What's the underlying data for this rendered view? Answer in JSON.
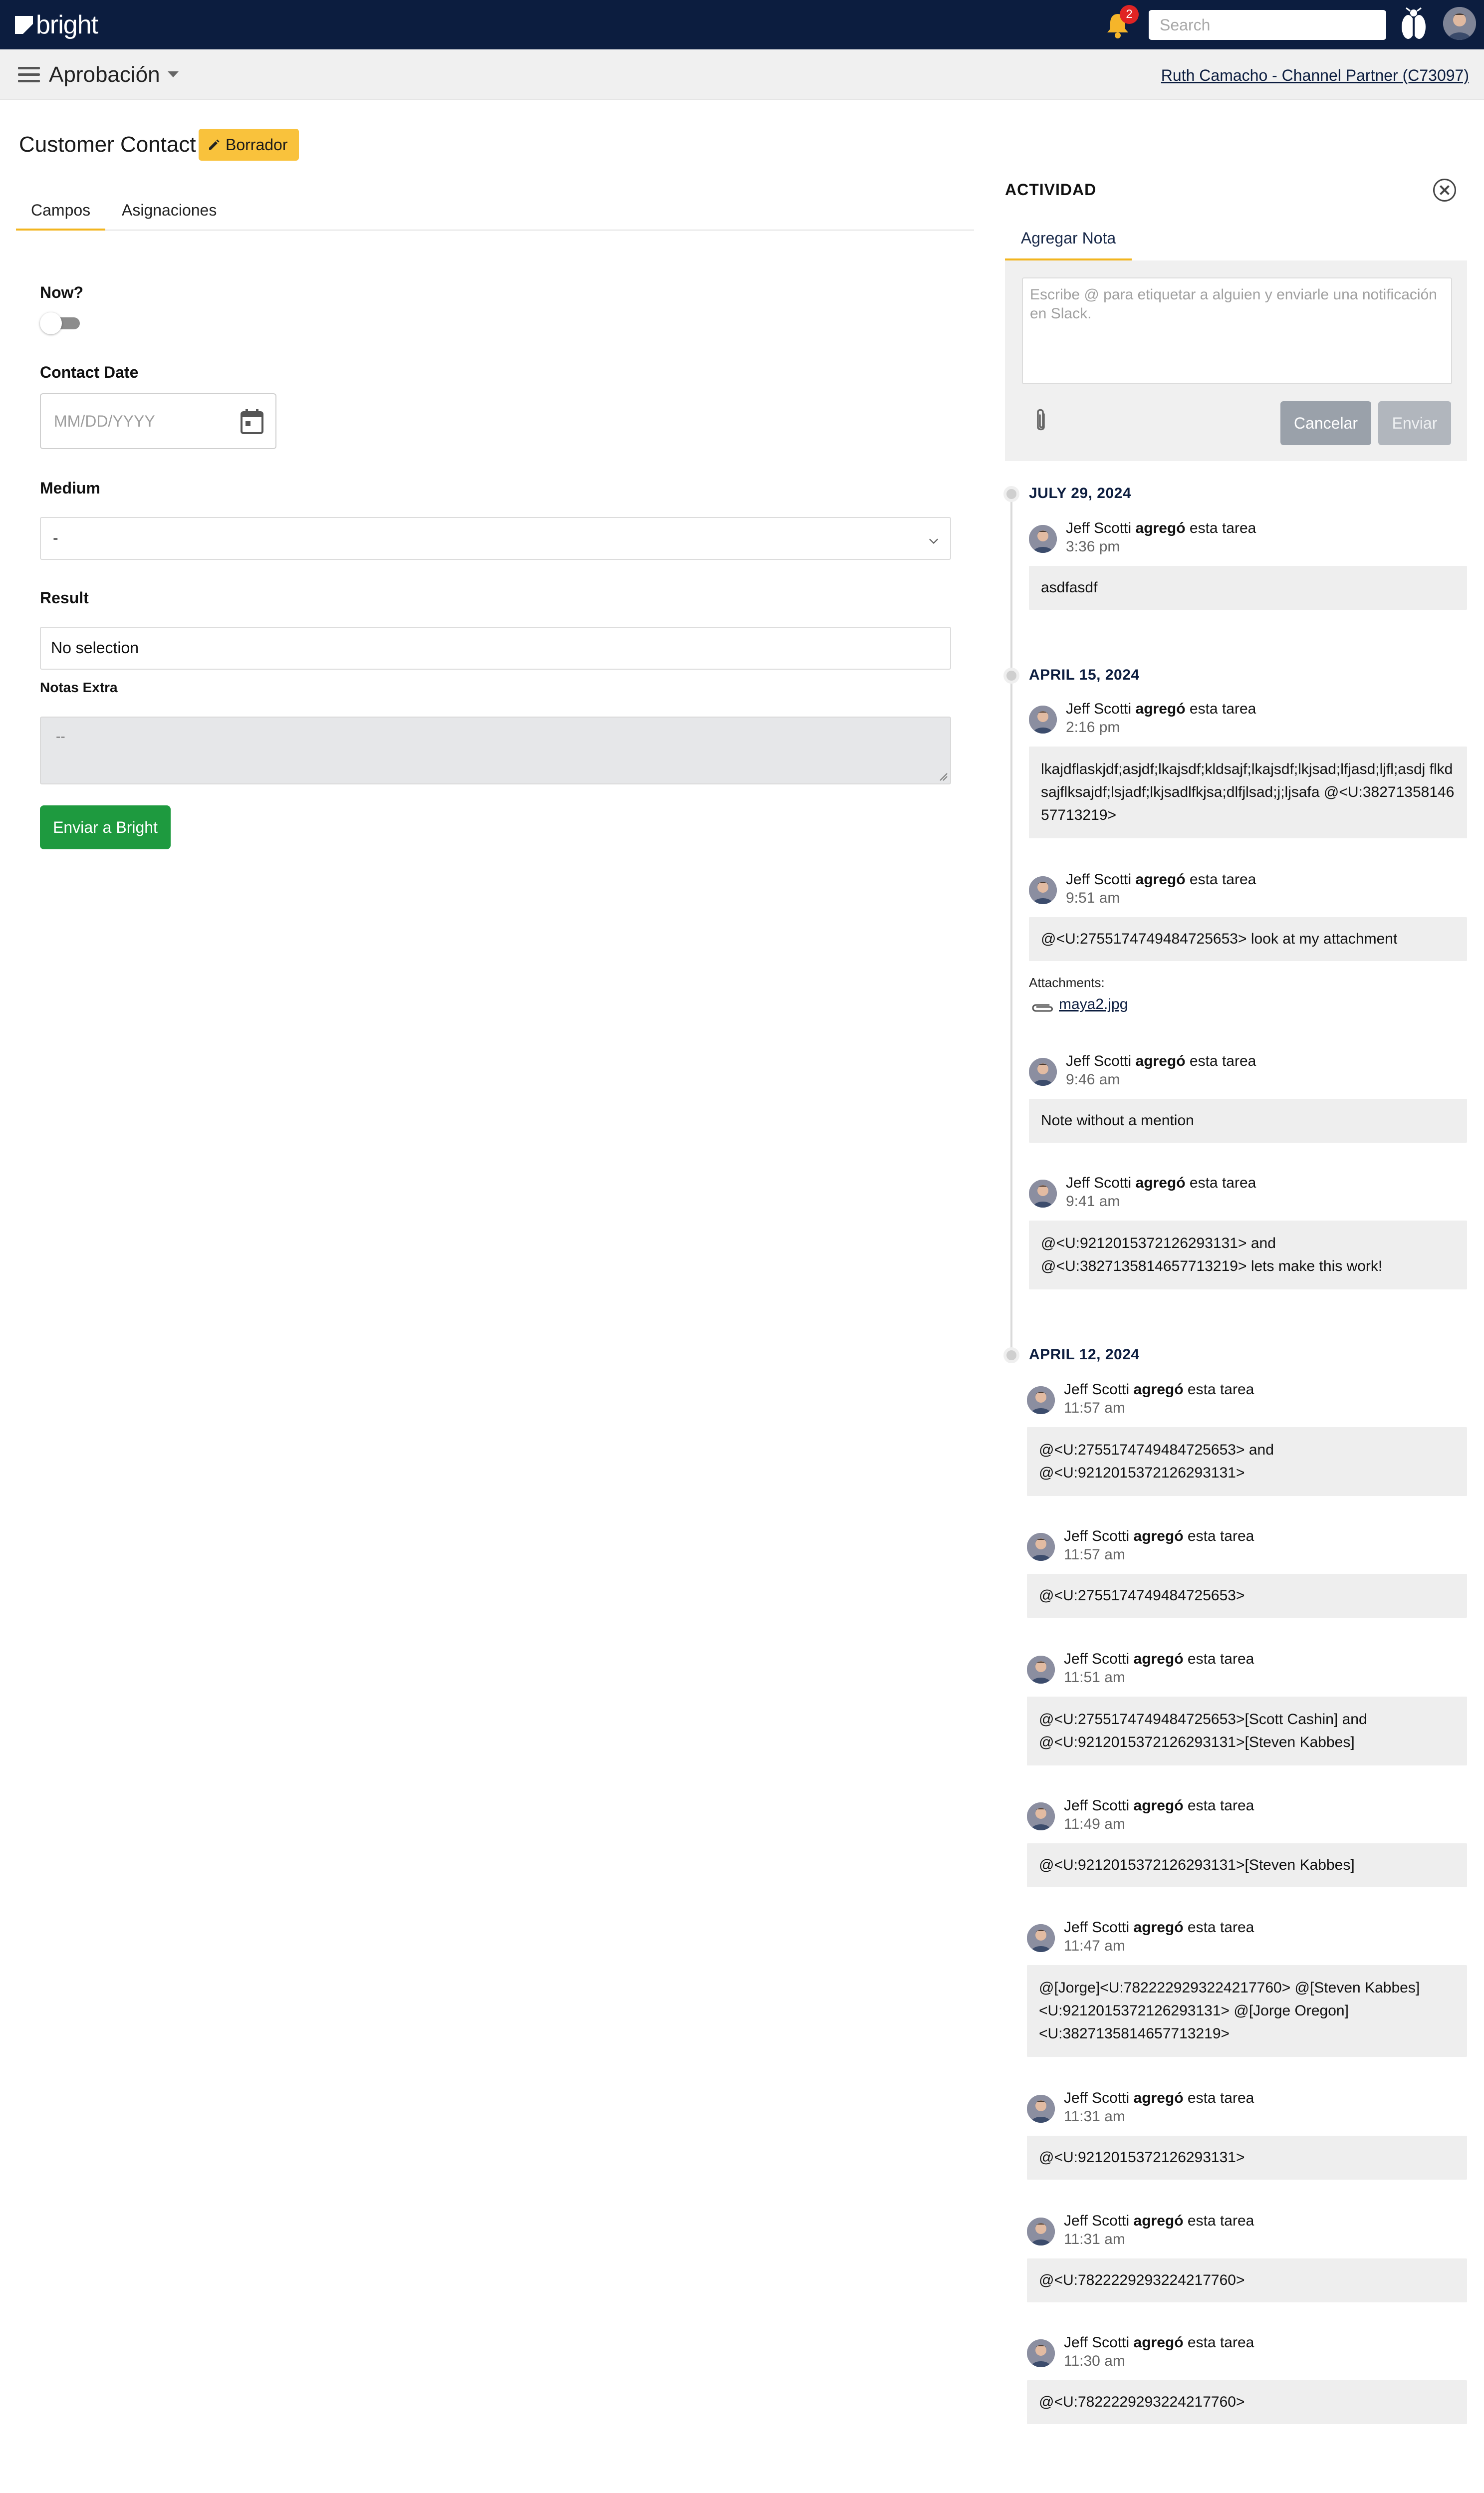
{
  "topbar": {
    "brand": "bright",
    "notification_count": "2",
    "search_placeholder": "Search"
  },
  "subbar": {
    "title": "Aprobación",
    "partner": "Ruth Camacho - Channel Partner (C73097)"
  },
  "form": {
    "title": "Customer Contact",
    "status_badge": "Borrador",
    "tabs": [
      "Campos",
      "Asignaciones"
    ],
    "active_tab": "Campos",
    "fields": {
      "now_label": "Now?",
      "now_value": false,
      "contact_date_label": "Contact Date",
      "contact_date_placeholder": "MM/DD/YYYY",
      "medium_label": "Medium",
      "medium_value": "-",
      "result_label": "Result",
      "result_value": "No selection",
      "extra_label": "Notas Extra",
      "extra_placeholder": "--"
    },
    "submit_label": "Enviar a Bright"
  },
  "activity": {
    "title": "ACTIVIDAD",
    "tab": "Agregar Nota",
    "note_placeholder": "Escribe @ para etiquetar a alguien y enviarle una notificación en Slack.",
    "cancel_label": "Cancelar",
    "send_label": "Enviar",
    "attachments_label": "Attachments:",
    "attachment_file": "maya2.jpg",
    "groups": [
      {
        "date": "JULY 29, 2024"
      },
      {
        "date": "APRIL 15, 2024"
      },
      {
        "date": "APRIL 12, 2024"
      }
    ],
    "entries": [
      {
        "author": "Jeff Scotti",
        "verb": "agregó",
        "suffix": "esta tarea",
        "time": "3:36 pm",
        "body": "asdfasdf"
      },
      {
        "author": "Jeff Scotti",
        "verb": "agregó",
        "suffix": "esta tarea",
        "time": "2:16 pm",
        "body": "lkajdflaskjdf;asjdf;lkajsdf;kldsajf;lkajsdf;lkjsad;lfjasd;ljfl;asdj flkdsajflksajdf;lsjadf;lkjsadlfkjsa;dlfjlsad;j;ljsafa @<U:3827135814657713219>"
      },
      {
        "author": "Jeff Scotti",
        "verb": "agregó",
        "suffix": "esta tarea",
        "time": "9:51 am",
        "body": "@<U:2755174749484725653> look at my attachment"
      },
      {
        "author": "Jeff Scotti",
        "verb": "agregó",
        "suffix": "esta tarea",
        "time": "9:46 am",
        "body": "Note without a mention"
      },
      {
        "author": "Jeff Scotti",
        "verb": "agregó",
        "suffix": "esta tarea",
        "time": "9:41 am",
        "body": "@<U:9212015372126293131> and\n@<U:3827135814657713219> lets make this work!"
      },
      {
        "author": "Jeff Scotti",
        "verb": "agregó",
        "suffix": "esta tarea",
        "time": "11:57 am",
        "body": "@<U:2755174749484725653> and\n@<U:9212015372126293131>"
      },
      {
        "author": "Jeff Scotti",
        "verb": "agregó",
        "suffix": "esta tarea",
        "time": "11:57 am",
        "body": "@<U:2755174749484725653>"
      },
      {
        "author": "Jeff Scotti",
        "verb": "agregó",
        "suffix": "esta tarea",
        "time": "11:51 am",
        "body": "@<U:2755174749484725653>[Scott Cashin] and\n@<U:9212015372126293131>[Steven Kabbes]"
      },
      {
        "author": "Jeff Scotti",
        "verb": "agregó",
        "suffix": "esta tarea",
        "time": "11:49 am",
        "body": "@<U:9212015372126293131>[Steven Kabbes]"
      },
      {
        "author": "Jeff Scotti",
        "verb": "agregó",
        "suffix": "esta tarea",
        "time": "11:47 am",
        "body": "@[Jorge]<U:7822229293224217760> @[Steven Kabbes]\n<U:9212015372126293131> @[Jorge Oregon]\n<U:3827135814657713219>"
      },
      {
        "author": "Jeff Scotti",
        "verb": "agregó",
        "suffix": "esta tarea",
        "time": "11:31 am",
        "body": "@<U:9212015372126293131>"
      },
      {
        "author": "Jeff Scotti",
        "verb": "agregó",
        "suffix": "esta tarea",
        "time": "11:31 am",
        "body": "@<U:7822229293224217760>"
      },
      {
        "author": "Jeff Scotti",
        "verb": "agregó",
        "suffix": "esta tarea",
        "time": "11:30 am",
        "body": "@<U:7822229293224217760>"
      }
    ]
  },
  "colors": {
    "navbar": "#0c1d3f",
    "accent_yellow": "#f2b51f",
    "badge_yellow": "#f9c23c",
    "submit_green": "#1e9a3f",
    "notification_red": "#e02424"
  }
}
